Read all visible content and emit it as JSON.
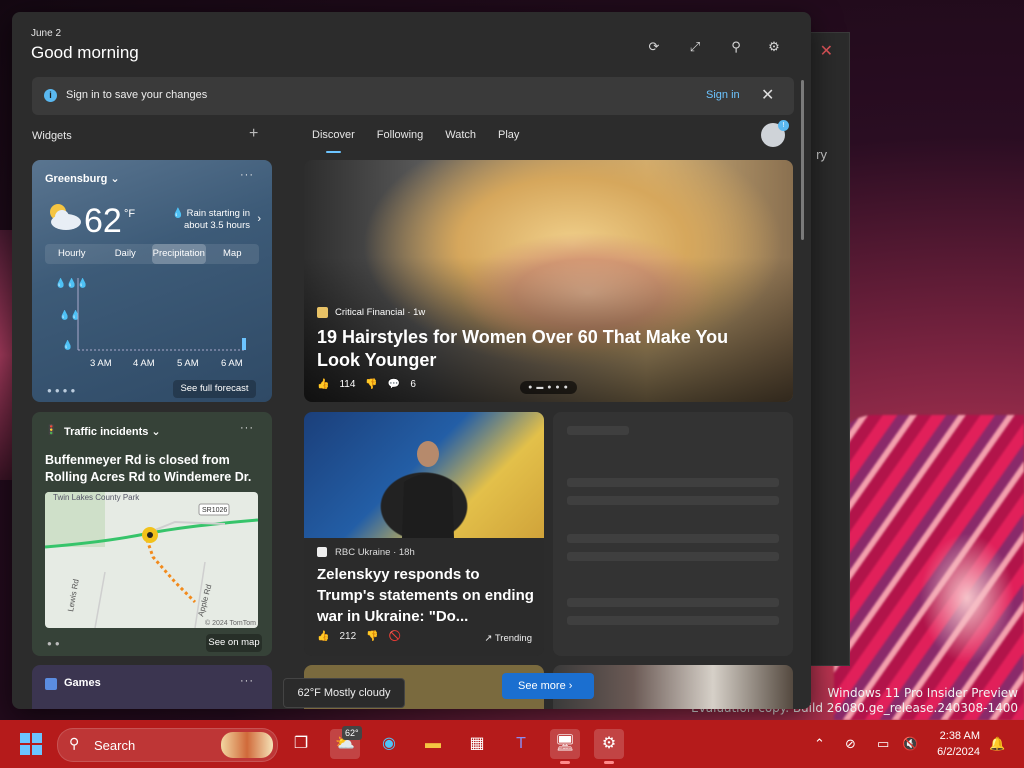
{
  "panel": {
    "date": "June 2",
    "greeting": "Good morning"
  },
  "signin": {
    "message": "Sign in to save your changes",
    "link": "Sign in"
  },
  "widgets": {
    "title": "Widgets"
  },
  "tabs": [
    "Discover",
    "Following",
    "Watch",
    "Play"
  ],
  "weather": {
    "location": "Greensburg",
    "temp": "62",
    "unit": "°F",
    "rain_line1": "Rain starting in",
    "rain_line2": "about 3.5 hours",
    "tabs": [
      "Hourly",
      "Daily",
      "Precipitation",
      "Map"
    ],
    "times": [
      "3 AM",
      "4 AM",
      "5 AM",
      "6 AM"
    ],
    "forecast_button": "See full forecast"
  },
  "traffic": {
    "title": "Traffic incidents",
    "headline": "Buffenmeyer Rd is closed from Rolling Acres Rd to Windemere Dr.",
    "map_labels": {
      "park": "Twin Lakes County Park",
      "route": "SR1026",
      "road1": "Lewis Rd",
      "road2": "Apple Rd",
      "copyright": "© 2024 TomTom"
    },
    "see_map": "See on map"
  },
  "games": {
    "title": "Games"
  },
  "hero": {
    "source": "Critical Financial · 1w",
    "title": "19 Hairstyles for Women Over 60 That Make You Look Younger",
    "likes": "114",
    "comments": "6"
  },
  "zelensky": {
    "source": "RBC Ukraine · 18h",
    "title": "Zelenskyy responds to Trump's statements on ending war in Ukraine: \"Do...",
    "likes": "212",
    "trending": "Trending"
  },
  "tooltip": "62°F Mostly cloudy",
  "see_more": "See more",
  "watermark": {
    "line1": "Windows 11 Pro Insider Preview",
    "line2": "Evaluation copy. Build 26080.ge_release.240308-1400"
  },
  "taskbar": {
    "search": "Search",
    "weather_badge": "62°",
    "time": "2:38 AM",
    "date": "6/2/2024"
  },
  "background_window": {
    "text": "ry"
  },
  "colors": {
    "accent": "#6cc4ff",
    "taskbar": "#b51b1b",
    "see_more": "#1b6fd0"
  }
}
